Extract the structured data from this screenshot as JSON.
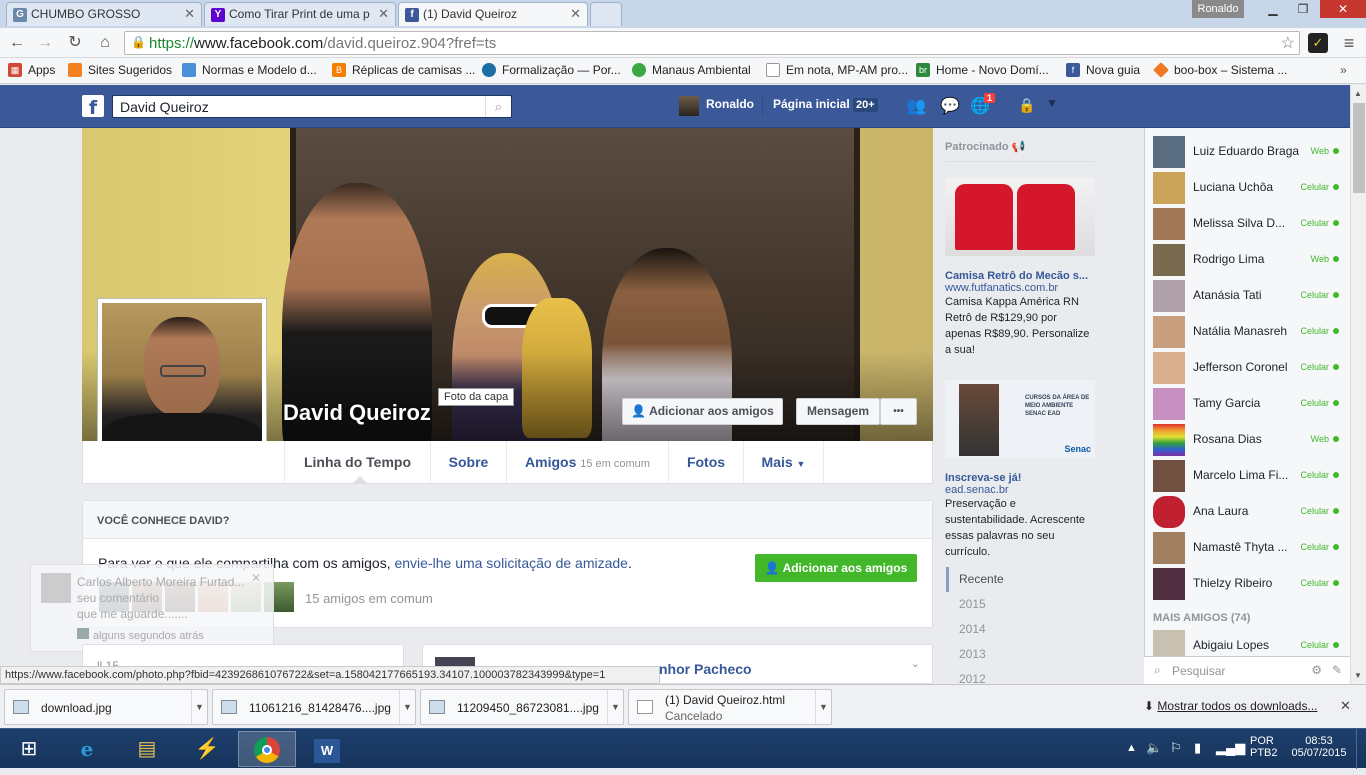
{
  "browser": {
    "tabs": [
      {
        "title": "CHUMBO GROSSO",
        "icon": "g-favicon",
        "color": "#6a88a8"
      },
      {
        "title": "Como Tirar Print de uma p",
        "icon": "yahoo-favicon",
        "color": "#6001d2"
      },
      {
        "title": "(1) David Queiroz",
        "icon": "facebook-favicon",
        "color": "#3b5998"
      }
    ],
    "profile_name": "Ronaldo",
    "url_scheme": "https://",
    "url_host": "www.facebook.com",
    "url_path": "/david.queiroz.904?fref=ts",
    "bookmarks": [
      {
        "label": "Apps",
        "icon": "apps-grid-icon",
        "color": "#d14836"
      },
      {
        "label": "Sites Sugeridos",
        "icon": "suggested-sites-icon",
        "color": "#f48120"
      },
      {
        "label": "Normas e Modelo d...",
        "icon": "page-icon",
        "color": "#4a90d9"
      },
      {
        "label": "Réplicas de camisas ...",
        "icon": "blogger-icon",
        "color": "#f57d00"
      },
      {
        "label": "Formalização — Por...",
        "icon": "globe-icon",
        "color": "#1c6ea4"
      },
      {
        "label": "Manaus Ambiental",
        "icon": "leaf-icon",
        "color": "#3aa845"
      },
      {
        "label": "Em nota, MP-AM pro...",
        "icon": "document-icon",
        "color": "#999999"
      },
      {
        "label": "Home - Novo Domí...",
        "icon": "br-icon",
        "color": "#2c8a3c"
      },
      {
        "label": "Nova guia",
        "icon": "facebook-icon",
        "color": "#3b5998"
      },
      {
        "label": "boo-box – Sistema ...",
        "icon": "boobox-icon",
        "color": "#f07820"
      }
    ]
  },
  "fb": {
    "search_value": "David Queiroz",
    "user_name": "Ronaldo",
    "home_label": "Página inicial",
    "home_badge": "20+",
    "notif_badge": "1"
  },
  "profile": {
    "name": "David Queiroz",
    "cover_tooltip": "Foto da capa",
    "add_friend": "Adicionar aos amigos",
    "message": "Mensagem",
    "more_dots": "•••",
    "tabs": {
      "timeline": "Linha do Tempo",
      "about": "Sobre",
      "friends": "Amigos",
      "friends_common": "15 em comum",
      "photos": "Fotos",
      "more": "Mais"
    }
  },
  "know_box": {
    "heading": "VOCÊ CONHECE DAVID?",
    "text_prefix": "Para ver o que ele compartilha com os amigos,",
    "text_link": "envie-lhe uma solicitação de amizade",
    "text_suffix": ".",
    "button": "Adicionar aos amigos",
    "mutual": "15 amigos em comum"
  },
  "notification": {
    "line1": "Carlos Alberto Moreira Furtad...",
    "line2": "seu comentário",
    "line3": "que me aguarde.......",
    "time": "alguns segundos atrás"
  },
  "lower": {
    "post_author": "nhor Pacheco",
    "left_partial": "ll 15 ..."
  },
  "ads": {
    "header": "Patrocinado",
    "ad1_title": "Camisa Retrô do Mecão s...",
    "ad1_url": "www.futfanatics.com.br",
    "ad1_text": "Camisa Kappa América RN Retrô de R$129,90 por apenas R$89,90. Personalize a sua!",
    "ad2_banner_text": "CURSOS DA ÁREA DE MEIO AMBIENTE SENAC EAD",
    "ad2_logo": "Senac",
    "ad2_title": "Inscreva-se já!",
    "ad2_url": "ead.senac.br",
    "ad2_text": "Preservação e sustentabilidade. Acrescente essas palavras no seu currículo."
  },
  "years": {
    "recent": "Recente",
    "list": [
      "2015",
      "2014",
      "2013",
      "2012"
    ]
  },
  "chat": {
    "contacts": [
      {
        "name": "Luiz Eduardo Braga",
        "status": "Web",
        "color": "#5a6c80"
      },
      {
        "name": "Luciana Uchôa",
        "status": "Celular",
        "color": "#c9a45a"
      },
      {
        "name": "Melissa Silva D...",
        "status": "Celular",
        "color": "#a07858"
      },
      {
        "name": "Rodrigo Lima",
        "status": "Web",
        "color": "#7a6a50"
      },
      {
        "name": "Atanásia Tati",
        "status": "Celular",
        "color": "#b0a0a8"
      },
      {
        "name": "Natália Manasreh",
        "status": "Celular",
        "color": "#c8a080"
      },
      {
        "name": "Jefferson Coronel",
        "status": "Celular",
        "color": "#d8b090"
      },
      {
        "name": "Tamy Garcia",
        "status": "Celular",
        "color": "#c890c0"
      },
      {
        "name": "Rosana Dias",
        "status": "Web",
        "color": "#e05050"
      },
      {
        "name": "Marcelo Lima Fi...",
        "status": "Celular",
        "color": "#705040"
      },
      {
        "name": "Ana Laura",
        "status": "Celular",
        "color": "#c02030"
      },
      {
        "name": "Namastê Thyta ...",
        "status": "Celular",
        "color": "#a08060"
      },
      {
        "name": "Thielzy Ribeiro",
        "status": "Celular",
        "color": "#503040"
      }
    ],
    "more_header": "MAIS AMIGOS (74)",
    "more_contact": {
      "name": "Abigaiu Lopes",
      "status": "Celular"
    },
    "search_placeholder": "Pesquisar"
  },
  "statusbar": "https://www.facebook.com/photo.php?fbid=423926861076722&set=a.158042177665193.34107.100003782343999&type=1",
  "downloads": {
    "items": [
      {
        "name": "download.jpg",
        "sub": ""
      },
      {
        "name": "11061216_81428476....jpg",
        "sub": ""
      },
      {
        "name": "11209450_86723081....jpg",
        "sub": ""
      },
      {
        "name": "(1) David Queiroz.html",
        "sub": "Cancelado"
      }
    ],
    "show_all": "Mostrar todos os downloads..."
  },
  "taskbar": {
    "lang": "POR",
    "layout": "PTB2",
    "time": "08:53",
    "date": "05/07/2015"
  }
}
